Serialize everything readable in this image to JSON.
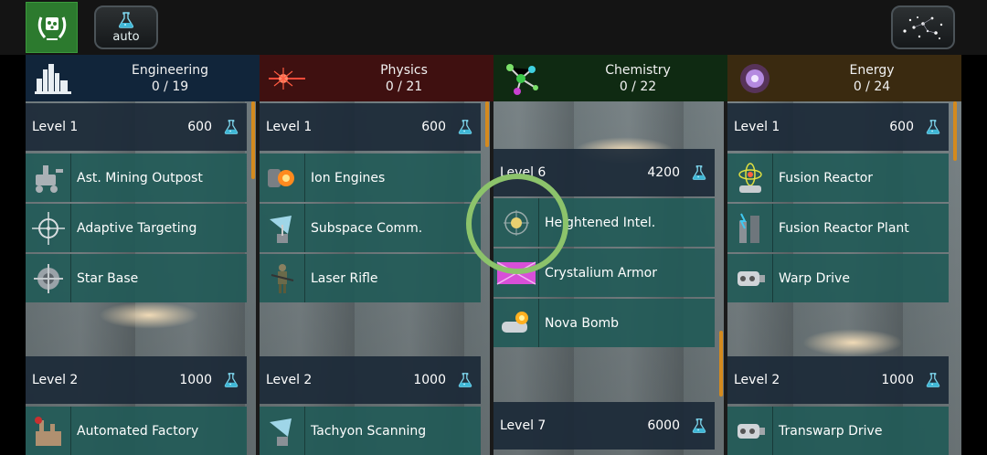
{
  "topbar": {
    "auto_label": "auto"
  },
  "categories": [
    {
      "name": "Engineering",
      "progress": "0 / 19",
      "icon": "skyline-icon",
      "color": "#11253a"
    },
    {
      "name": "Physics",
      "progress": "0 / 21",
      "icon": "laser-burst-icon",
      "color": "#3f1010"
    },
    {
      "name": "Chemistry",
      "progress": "0 / 22",
      "icon": "molecule-icon",
      "color": "#0f2a12"
    },
    {
      "name": "Energy",
      "progress": "0 / 24",
      "icon": "energy-orb-icon",
      "color": "#3a2a10"
    }
  ],
  "columns": {
    "engineering": {
      "level1": {
        "name": "Level 1",
        "cost": "600"
      },
      "techs1": [
        "Ast. Mining Outpost",
        "Adaptive Targeting",
        "Star Base"
      ],
      "level2": {
        "name": "Level 2",
        "cost": "1000"
      },
      "techs2": [
        "Automated Factory"
      ]
    },
    "physics": {
      "level1": {
        "name": "Level 1",
        "cost": "600"
      },
      "techs1": [
        "Ion Engines",
        "Subspace Comm.",
        "Laser Rifle"
      ],
      "level2": {
        "name": "Level 2",
        "cost": "1000"
      },
      "techs2": [
        "Tachyon Scanning"
      ]
    },
    "chemistry": {
      "level6": {
        "name": "Level 6",
        "cost": "4200"
      },
      "techs6": [
        "Heightened Intel.",
        "Crystalium Armor",
        "Nova Bomb"
      ],
      "level7": {
        "name": "Level 7",
        "cost": "6000"
      }
    },
    "energy": {
      "level1": {
        "name": "Level 1",
        "cost": "600"
      },
      "techs1": [
        "Fusion Reactor",
        "Fusion Reactor Plant",
        "Warp Drive"
      ],
      "level2": {
        "name": "Level 2",
        "cost": "1000"
      },
      "techs2": [
        "Transwarp Drive"
      ]
    }
  },
  "colors": {
    "accent_green": "#8cc36b",
    "tech_row": "#205a56",
    "level_bar": "#1c2a38",
    "scrollbar": "#d48a1e",
    "flask": "#3fb7d6"
  }
}
